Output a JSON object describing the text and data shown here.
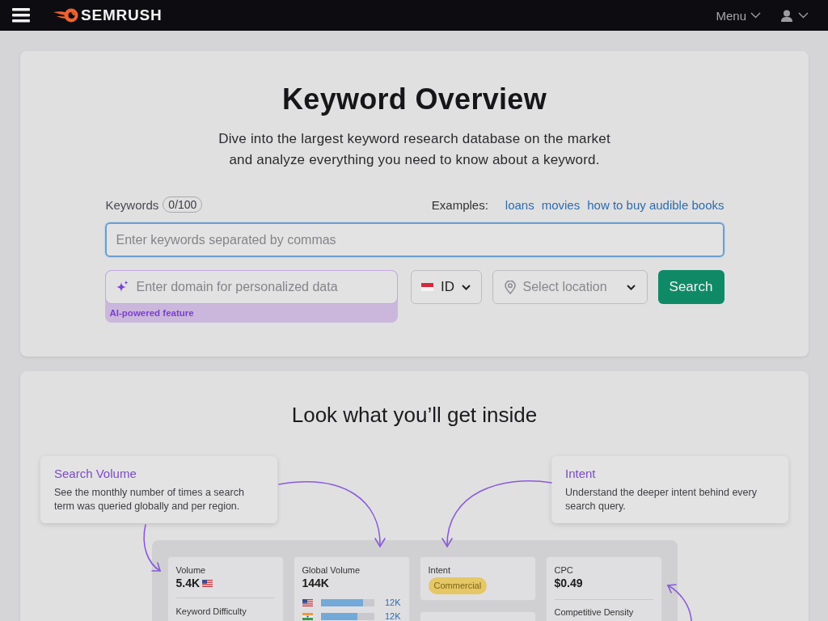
{
  "top_bar": {
    "logo_text": "SEMRUSH",
    "menu_label": "Menu"
  },
  "hero": {
    "title": "Keyword Overview",
    "subtitle": [
      "Dive into the largest keyword research database on the market",
      "and analyze everything you need to know about a keyword."
    ]
  },
  "keywords": {
    "label": "Keywords",
    "counter": "0/100",
    "examples_label": "Examples:",
    "examples": [
      "loans",
      "movies",
      "how to buy audible books"
    ],
    "input": {
      "placeholder": "Enter keywords separated by commas",
      "focused": true
    }
  },
  "domain": {
    "placeholder": "Enter domain for personalized data",
    "note": "AI-powered feature"
  },
  "database_select": {
    "value": "ID"
  },
  "location_select": {
    "placeholder": "Select location"
  },
  "search_button": "Search",
  "features": {
    "title": "Look what you’ll get inside",
    "callouts": [
      {
        "title": "Search Volume",
        "text": "See the monthly number of times a search term was queried globally and per region."
      },
      {
        "title": "Intent",
        "text": "Understand the deeper intent behind every search query."
      }
    ]
  },
  "preview": {
    "volume": {
      "label": "Volume",
      "value": "5.4K"
    },
    "keyword_difficulty": {
      "label": "Keyword Difficulty"
    },
    "global_volume": {
      "label": "Global Volume",
      "value": "144K",
      "rows": [
        {
          "kind": "us",
          "value": "12K",
          "level": 0.79
        },
        {
          "kind": "in",
          "value": "12K",
          "level": 0.69
        }
      ]
    },
    "intent": {
      "label": "Intent",
      "badge": "Commercial"
    },
    "cpc": {
      "label": "CPC",
      "value": "$0.49"
    },
    "competitive_density": {
      "label": "Competitive Density"
    }
  }
}
